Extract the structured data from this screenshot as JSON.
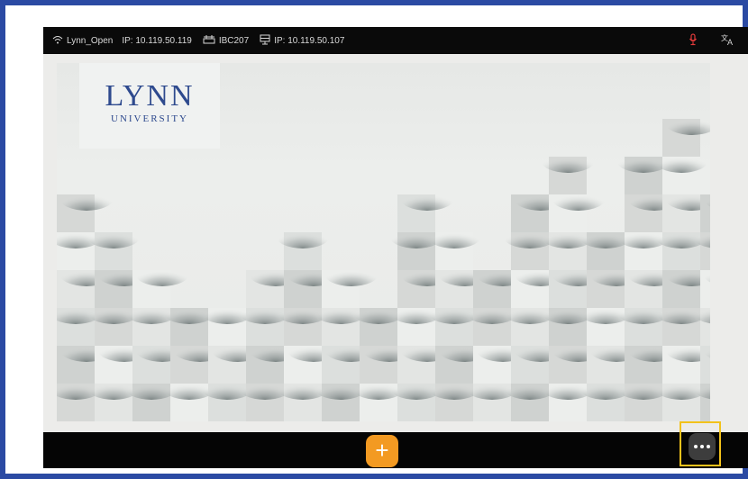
{
  "status_bar": {
    "wifi_icon": "wifi-icon",
    "network_name": "Lynn_Open",
    "client_ip": "IP: 10.119.50.119",
    "room_icon": "room-network-icon",
    "room_name": "IBC207",
    "device_icon": "device-icon",
    "device_ip": "IP: 10.119.50.107",
    "mic_icon": "microphone-icon",
    "translate_icon": "translate-icon"
  },
  "branding": {
    "logo_name": "LYNN",
    "logo_sub": "UNIVERSITY",
    "logo_color": "#2e4a8e"
  },
  "toolbar": {
    "add_label": "+",
    "add_color": "#f39a22",
    "more_icon": "more-options-icon",
    "highlight_color": "#f2c21b"
  },
  "colors": {
    "frame": "#2b4aa3",
    "mic_active": "#e03a3a"
  }
}
